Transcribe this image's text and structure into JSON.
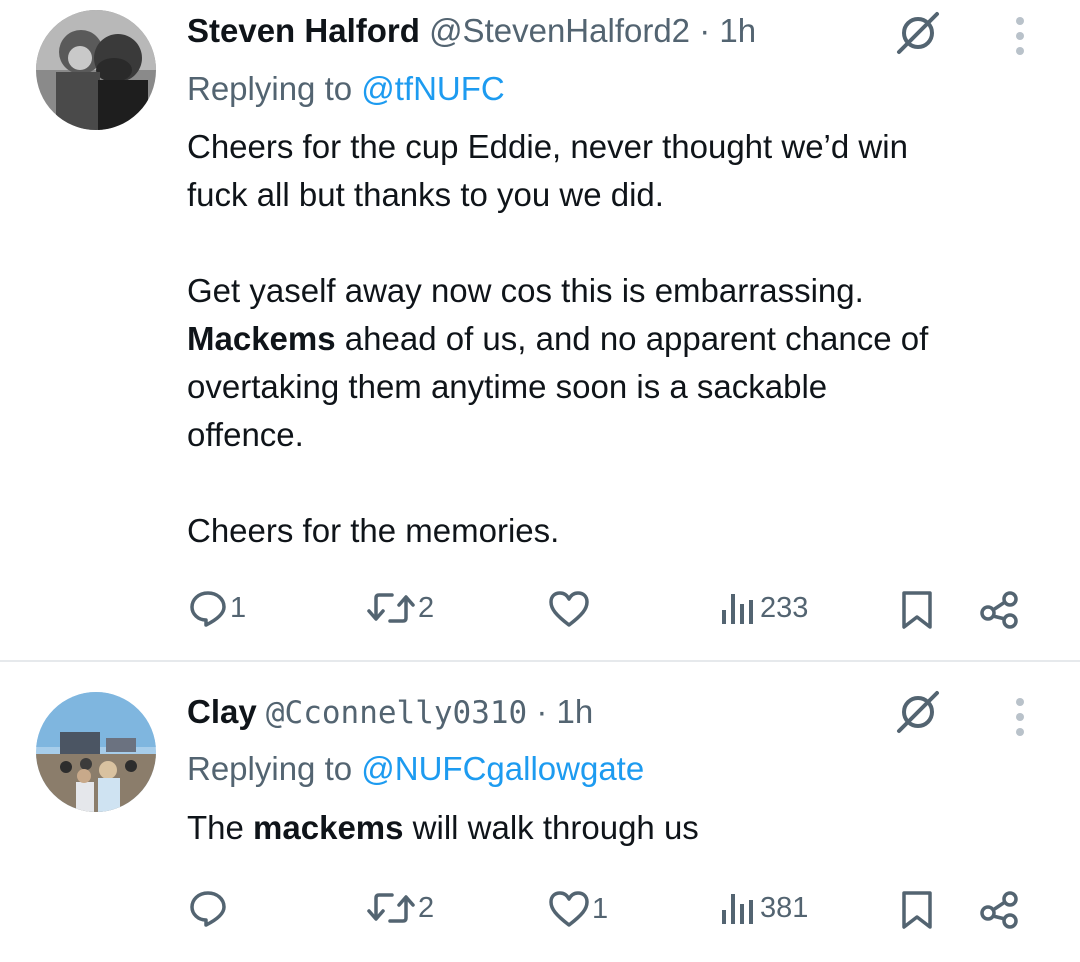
{
  "tweets": [
    {
      "author_name": "Steven Halford",
      "handle": "@StevenHalford2",
      "separator": "·",
      "time": "1h",
      "replying_prefix": "Replying to ",
      "replying_handle": "@tfNUFC",
      "body": {
        "line1": "Cheers for the cup Eddie, never thought we’d win",
        "line2": "fuck all but thanks to you we did.",
        "line3": "Get yaself away now cos this is embarrassing.",
        "line4_bold": "Mackems",
        "line4_rest": " ahead of us, and no apparent chance of",
        "line5": "overtaking them anytime soon is a sackable",
        "line6": "offence.",
        "line7": "Cheers for the memories."
      },
      "actions": {
        "replies": "1",
        "retweets": "2",
        "likes": "",
        "views": "233"
      },
      "icons": [
        "grok-icon",
        "more-icon",
        "reply-icon",
        "retweet-icon",
        "like-icon",
        "views-icon",
        "bookmark-icon",
        "share-icon"
      ]
    },
    {
      "author_name": "Clay",
      "handle": "@Cconnelly0310",
      "separator": "·",
      "time": "1h",
      "replying_prefix": "Replying to ",
      "replying_handle": "@NUFCgallowgate",
      "body": {
        "prefix": "The ",
        "bold": "mackems",
        "rest": " will walk through us"
      },
      "actions": {
        "replies": "",
        "retweets": "2",
        "likes": "1",
        "views": "381"
      },
      "icons": [
        "grok-icon",
        "more-icon",
        "reply-icon",
        "retweet-icon",
        "like-icon",
        "views-icon",
        "bookmark-icon",
        "share-icon"
      ]
    }
  ],
  "colors": {
    "text": "#0f1419",
    "secondary": "#536471",
    "link": "#1d9bf0",
    "divider": "#e6e9ec"
  }
}
